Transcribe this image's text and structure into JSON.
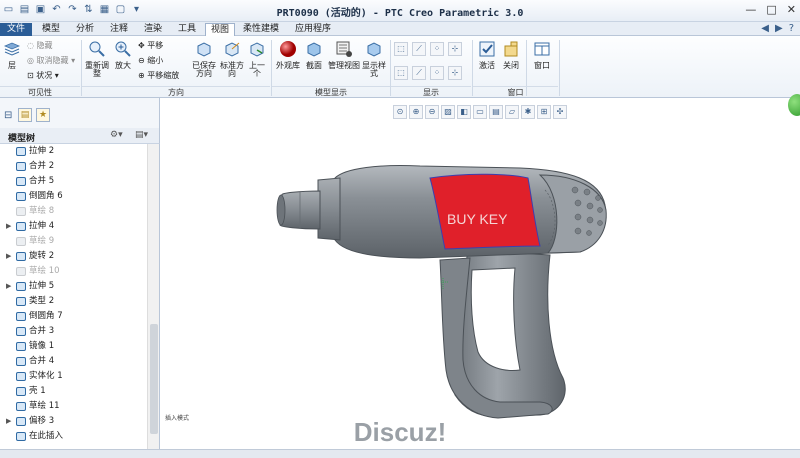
{
  "window": {
    "title": "PRT0090 (活动的) - PTC Creo Parametric 3.0",
    "controls": [
      "—",
      "□",
      "✕"
    ]
  },
  "tabs": [
    "文件",
    "模型",
    "分析",
    "注释",
    "渲染",
    "工具",
    "视图",
    "柔性建模",
    "应用程序"
  ],
  "active_tab": "视图",
  "ribbon": {
    "visibility": {
      "layers": "层",
      "hide": "隐藏",
      "unhide": "取消隐藏",
      "status": "状况",
      "group": "可见性"
    },
    "orientation": {
      "refit": "重新调整",
      "zoom_in": "放大",
      "pan": "平移",
      "zoom_out": "缩小",
      "pan_zoom": "平移缩放",
      "saved": "已保存方向",
      "standard": "标准方向",
      "previous": "上一个",
      "group": "方向"
    },
    "model_display": {
      "appearance": "外观库",
      "section": "截面",
      "manage_views": "管理视图",
      "display_style": "显示样式",
      "group": "模型显示"
    },
    "show": {
      "group": "显示"
    },
    "window": {
      "activate": "激活",
      "close": "关闭",
      "window": "窗口",
      "group": "窗口"
    }
  },
  "model_tree": {
    "header": "模型树",
    "items": [
      {
        "label": "拉伸 2",
        "expand": false,
        "dim": false
      },
      {
        "label": "合并 2",
        "expand": false,
        "dim": false
      },
      {
        "label": "合并 5",
        "expand": false,
        "dim": false
      },
      {
        "label": "倒圆角 6",
        "expand": false,
        "dim": false
      },
      {
        "label": "草绘 8",
        "expand": false,
        "dim": true
      },
      {
        "label": "拉伸 4",
        "expand": true,
        "dim": false
      },
      {
        "label": "草绘 9",
        "expand": false,
        "dim": true
      },
      {
        "label": "旋转 2",
        "expand": true,
        "dim": false
      },
      {
        "label": "草绘 10",
        "expand": false,
        "dim": true
      },
      {
        "label": "拉伸 5",
        "expand": true,
        "dim": false
      },
      {
        "label": "类型 2",
        "expand": false,
        "dim": false
      },
      {
        "label": "倒圆角 7",
        "expand": false,
        "dim": false
      },
      {
        "label": "合并 3",
        "expand": false,
        "dim": false
      },
      {
        "label": "镜像 1",
        "expand": false,
        "dim": false
      },
      {
        "label": "合并 4",
        "expand": false,
        "dim": false
      },
      {
        "label": "实体化 1",
        "expand": false,
        "dim": false
      },
      {
        "label": "壳 1",
        "expand": false,
        "dim": false
      },
      {
        "label": "草绘 11",
        "expand": false,
        "dim": false
      },
      {
        "label": "偏移 3",
        "expand": true,
        "dim": false
      },
      {
        "label": "在此插入",
        "expand": false,
        "dim": false
      }
    ]
  },
  "canvas": {
    "decal_text": "BUY  KEY",
    "insert_mode_label": "插入模式",
    "watermark": "Discuz!"
  },
  "colors": {
    "accent": "#2b5d97",
    "decal": "#e0202a",
    "body": "#7e848b"
  }
}
